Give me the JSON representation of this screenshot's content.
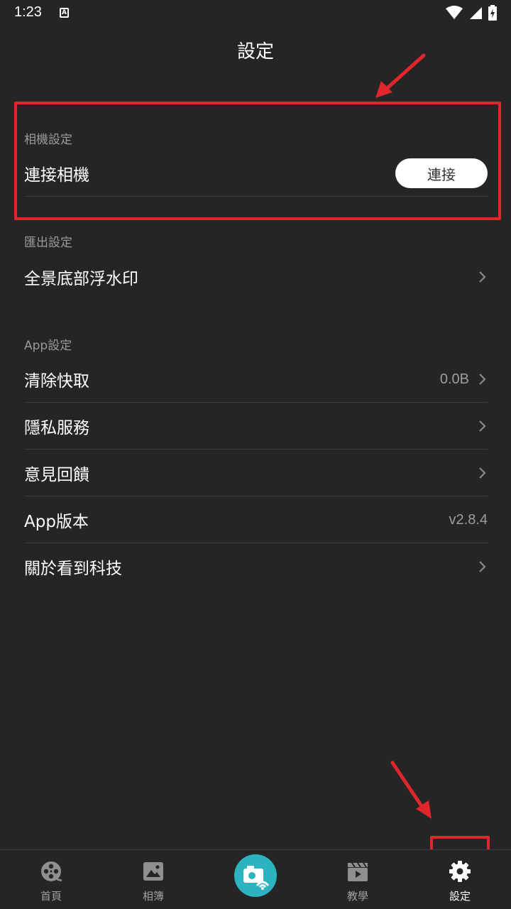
{
  "status": {
    "time": "1:23"
  },
  "header": {
    "title": "設定"
  },
  "sections": {
    "camera": {
      "header": "相機設定",
      "connect_label": "連接相機",
      "connect_button": "連接"
    },
    "export": {
      "header": "匯出設定",
      "watermark_label": "全景底部浮水印"
    },
    "app": {
      "header": "App設定",
      "clear_cache_label": "清除快取",
      "clear_cache_value": "0.0B",
      "privacy_label": "隱私服務",
      "feedback_label": "意見回饋",
      "version_label": "App版本",
      "version_value": "v2.8.4",
      "about_label": "關於看到科技"
    }
  },
  "nav": {
    "home": "首頁",
    "album": "相簿",
    "tutorial": "教學",
    "settings": "設定"
  },
  "colors": {
    "background": "#252525",
    "accent": "#2bb4c0",
    "annotation": "#e0262d"
  }
}
